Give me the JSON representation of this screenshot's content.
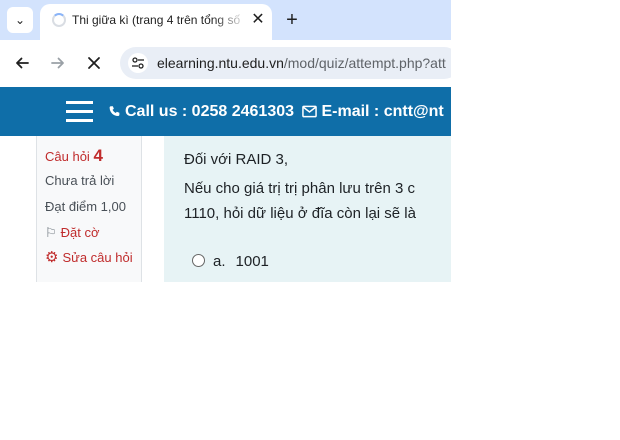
{
  "browser": {
    "tab": {
      "title": "Thi giữa kì (trang 4 trên tổng số",
      "close_glyph": "✕"
    },
    "tab_search_glyph": "⌄",
    "new_tab_glyph": "+",
    "url_host": "elearning.ntu.edu.vn",
    "url_path": "/mod/quiz/attempt.php?att",
    "icons": {
      "back": "back-arrow-icon",
      "forward": "forward-arrow-icon",
      "stop": "stop-loading-icon",
      "site_info": "tune-icon"
    }
  },
  "header": {
    "contact_text": "Call us : 0258 2461303",
    "email_text": "E-mail : cntt@nt",
    "bg_color": "#0f6ea8"
  },
  "question_nav": {
    "label": "Câu hỏi",
    "number": "4",
    "state": "Chưa trả lời",
    "grade": "Đạt điểm 1,00",
    "flag": "Đặt cờ",
    "edit": "Sửa câu hỏi"
  },
  "question": {
    "line1": "Đối với RAID 3,",
    "line2": "Nếu cho giá trị trị phân lưu trên 3  c",
    "line3": "1110, hỏi dữ liệu ở đĩa còn lại sẽ là",
    "answers": [
      {
        "letter": "a.",
        "text": "1001"
      }
    ]
  }
}
